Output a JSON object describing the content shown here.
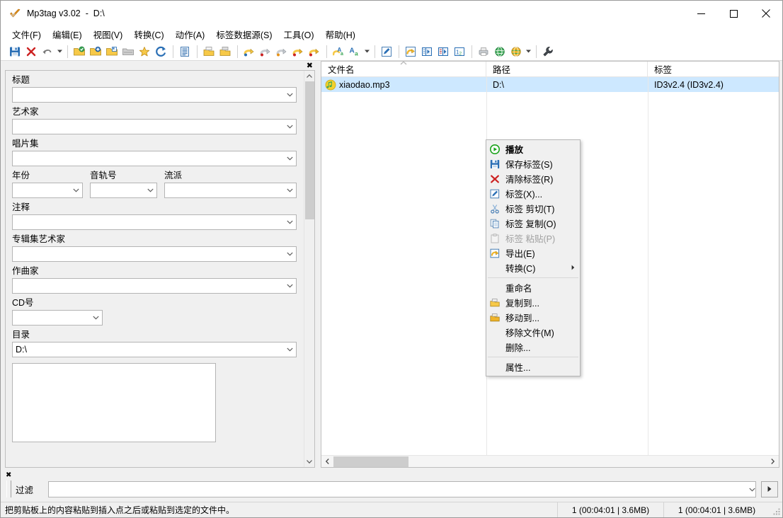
{
  "window": {
    "title": "Mp3tag v3.02  -  D:\\",
    "app_icon": "checkmark-icon",
    "minimize_label": "–",
    "maximize_label": "□",
    "close_label": "✕"
  },
  "menubar": {
    "items": [
      {
        "label": "文件(F)",
        "name": "menu-file"
      },
      {
        "label": "编辑(E)",
        "name": "menu-edit"
      },
      {
        "label": "视图(V)",
        "name": "menu-view"
      },
      {
        "label": "转换(C)",
        "name": "menu-convert"
      },
      {
        "label": "动作(A)",
        "name": "menu-actions"
      },
      {
        "label": "标签数据源(S)",
        "name": "menu-tag-sources"
      },
      {
        "label": "工具(O)",
        "name": "menu-tools"
      },
      {
        "label": "帮助(H)",
        "name": "menu-help"
      }
    ]
  },
  "toolbar": {
    "buttons": [
      {
        "name": "save-icon",
        "title": "保存"
      },
      {
        "name": "remove-icon",
        "title": "删除"
      },
      {
        "name": "undo-icon",
        "title": "撤销"
      },
      {
        "name": "undo-dropdown-icon",
        "title": "撤销列表"
      },
      {
        "name": "change-directory-icon",
        "title": "更改目录"
      },
      {
        "name": "add-directory-icon",
        "title": "添加目录"
      },
      {
        "name": "add-files-icon",
        "title": "添加文件"
      },
      {
        "name": "remove-folder-icon",
        "title": "移除"
      },
      {
        "name": "favorites-icon",
        "title": "收藏夹"
      },
      {
        "name": "refresh-icon",
        "title": "刷新"
      },
      {
        "name": "report-icon",
        "title": "报表"
      },
      {
        "name": "copy-tag-icon",
        "title": "复制标签"
      },
      {
        "name": "paste-tag-icon",
        "title": "粘贴标签"
      },
      {
        "name": "tag-to-filename-icon",
        "title": "标签 - 文件名"
      },
      {
        "name": "filename-to-tag-icon",
        "title": "文件名 - 标签"
      },
      {
        "name": "filename-to-filename-icon",
        "title": "文件名 - 文件名"
      },
      {
        "name": "tag-to-tag-icon",
        "title": "标签 - 标签"
      },
      {
        "name": "actions-icon",
        "title": "动作"
      },
      {
        "name": "actions-quick-icon",
        "title": "快速动作"
      },
      {
        "name": "actions-dropdown-icon",
        "title": "动作列表"
      },
      {
        "name": "tag-edit-icon",
        "title": "标签编辑"
      },
      {
        "name": "export-icon",
        "title": "导出"
      },
      {
        "name": "playlist-icon",
        "title": "播放列表"
      },
      {
        "name": "playlist2-icon",
        "title": "创建播放列表"
      },
      {
        "name": "auto-number-icon",
        "title": "自动编号向导"
      },
      {
        "name": "print-cover-icon",
        "title": "封面"
      },
      {
        "name": "tag-source-icon",
        "title": "标签数据源"
      },
      {
        "name": "tag-source2-icon",
        "title": "在线数据源"
      },
      {
        "name": "tag-source-dropdown-icon",
        "title": "数据源列表"
      },
      {
        "name": "options-icon",
        "title": "选项"
      }
    ]
  },
  "tag_panel": {
    "close_label": "✖",
    "fields": [
      {
        "label": "标题",
        "value": "",
        "name": "field-title"
      },
      {
        "label": "艺术家",
        "value": "",
        "name": "field-artist"
      },
      {
        "label": "唱片集",
        "value": "",
        "name": "field-album"
      },
      {
        "label": "年份",
        "value": "",
        "name": "field-year"
      },
      {
        "label": "音轨号",
        "value": "",
        "name": "field-track"
      },
      {
        "label": "流派",
        "value": "",
        "name": "field-genre"
      },
      {
        "label": "注释",
        "value": "",
        "name": "field-comment"
      },
      {
        "label": "专辑集艺术家",
        "value": "",
        "name": "field-albumartist"
      },
      {
        "label": "作曲家",
        "value": "",
        "name": "field-composer"
      },
      {
        "label": "CD号",
        "value": "",
        "name": "field-discnumber"
      },
      {
        "label": "目录",
        "value": "D:\\",
        "name": "field-directory"
      }
    ]
  },
  "file_list": {
    "columns": [
      {
        "label": "文件名",
        "name": "column-filename",
        "sorted": true
      },
      {
        "label": "路径",
        "name": "column-path",
        "sorted": false
      },
      {
        "label": "标签",
        "name": "column-tag",
        "sorted": false
      }
    ],
    "sort_caret": "▲",
    "rows": [
      {
        "filename": "xiaodao.mp3",
        "path": "D:\\",
        "tag": "ID3v2.4 (ID3v2.4)",
        "selected": true
      }
    ]
  },
  "context_menu": {
    "items": [
      {
        "type": "item",
        "label": "播放",
        "icon": "play-icon",
        "bold": true,
        "disabled": false,
        "name": "ctx-play"
      },
      {
        "type": "item",
        "label": "保存标签(S)",
        "icon": "save-icon",
        "bold": false,
        "disabled": false,
        "name": "ctx-save-tag"
      },
      {
        "type": "item",
        "label": "清除标签(R)",
        "icon": "remove-icon",
        "bold": false,
        "disabled": false,
        "name": "ctx-remove-tag"
      },
      {
        "type": "item",
        "label": "标签(X)...",
        "icon": "edit-tag-icon",
        "bold": false,
        "disabled": false,
        "name": "ctx-edit-tag"
      },
      {
        "type": "item",
        "label": "标签 剪切(T)",
        "icon": "cut-icon",
        "bold": false,
        "disabled": false,
        "name": "ctx-cut-tag"
      },
      {
        "type": "item",
        "label": "标签 复制(O)",
        "icon": "copy-icon",
        "bold": false,
        "disabled": false,
        "name": "ctx-copy-tag"
      },
      {
        "type": "item",
        "label": "标签 粘贴(P)",
        "icon": "paste-icon",
        "bold": false,
        "disabled": true,
        "name": "ctx-paste-tag"
      },
      {
        "type": "item",
        "label": "导出(E)",
        "icon": "export-icon",
        "bold": false,
        "disabled": false,
        "name": "ctx-export"
      },
      {
        "type": "item",
        "label": "转换(C)",
        "icon": "none",
        "bold": false,
        "disabled": false,
        "submenu": true,
        "name": "ctx-convert"
      },
      {
        "type": "separator"
      },
      {
        "type": "item",
        "label": "重命名",
        "icon": "none",
        "bold": false,
        "disabled": false,
        "name": "ctx-rename"
      },
      {
        "type": "item",
        "label": "复制到...",
        "icon": "copy-to-icon",
        "bold": false,
        "disabled": false,
        "name": "ctx-copy-to"
      },
      {
        "type": "item",
        "label": "移动到...",
        "icon": "move-to-icon",
        "bold": false,
        "disabled": false,
        "name": "ctx-move-to"
      },
      {
        "type": "item",
        "label": "移除文件(M)",
        "icon": "none",
        "bold": false,
        "disabled": false,
        "name": "ctx-remove-file"
      },
      {
        "type": "item",
        "label": "删除...",
        "icon": "none",
        "bold": false,
        "disabled": false,
        "name": "ctx-delete"
      },
      {
        "type": "separator"
      },
      {
        "type": "item",
        "label": "属性...",
        "icon": "none",
        "bold": false,
        "disabled": false,
        "name": "ctx-properties"
      }
    ],
    "submenu_arrow": "▶"
  },
  "filter_bar": {
    "close_label": "✖",
    "label": "过滤",
    "value": "",
    "placeholder": "",
    "apply_label": "▶"
  },
  "status_bar": {
    "message": "把剪贴板上的内容粘贴到插入点之后或粘贴到选定的文件中。",
    "selected_info": "1 (00:04:01 | 3.6MB)",
    "total_info": "1 (00:04:01 | 3.6MB)"
  },
  "colors": {
    "selection": "#cde8ff",
    "window_bg": "#f0f0f0",
    "accent_green": "#1aa21a",
    "accent_red": "#cc2222",
    "accent_blue": "#2a6fb5",
    "accent_gold": "#f0b429"
  }
}
